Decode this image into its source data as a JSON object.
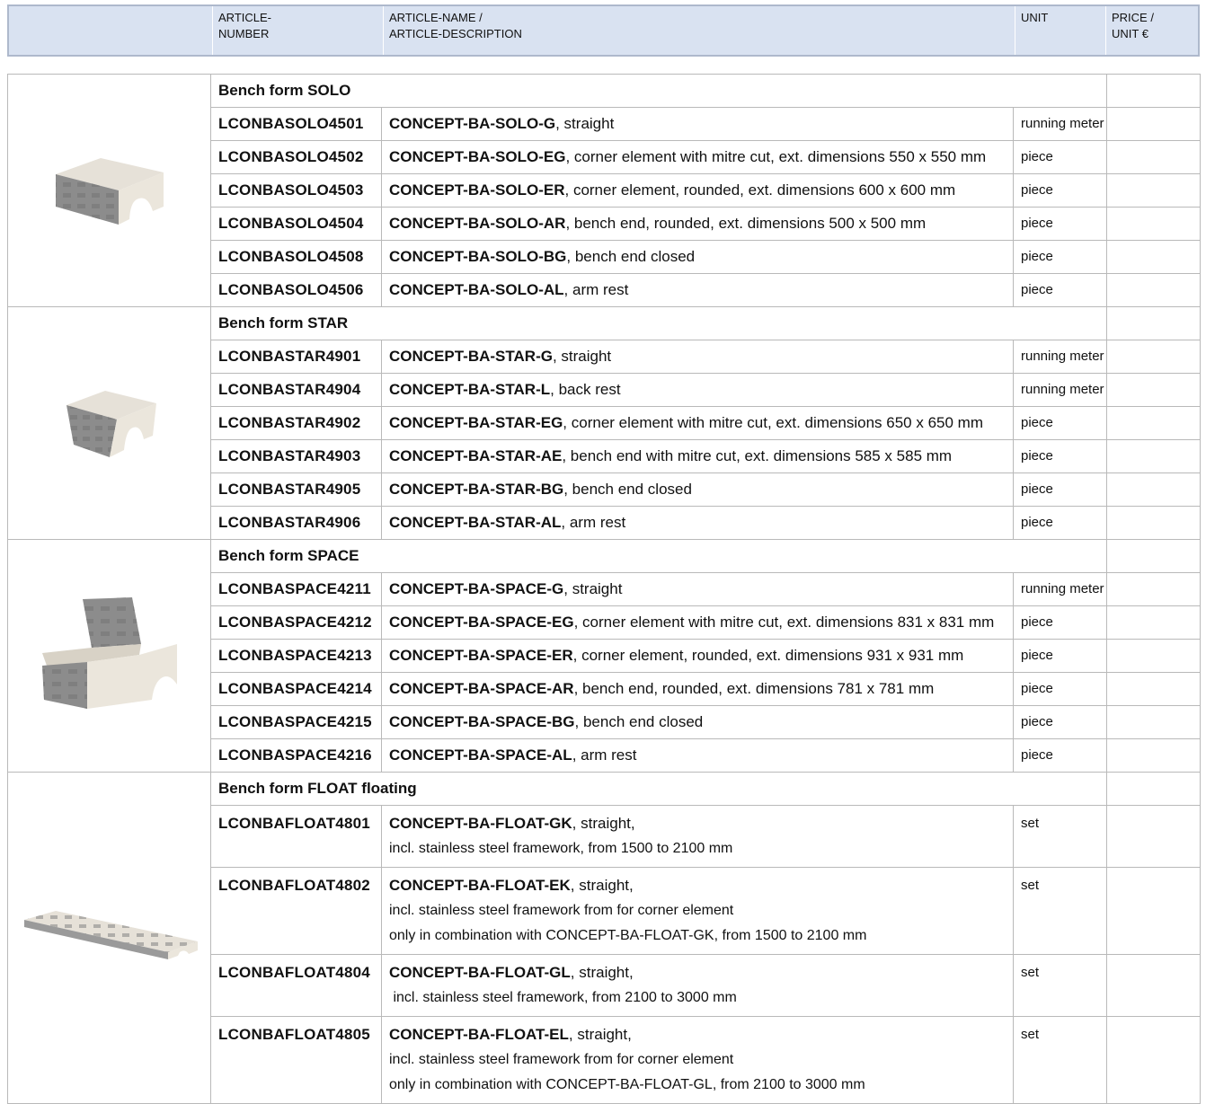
{
  "header": {
    "col_number": "ARTICLE-\nNUMBER",
    "col_name": "ARTICLE-NAME /\nARTICLE-DESCRIPTION",
    "col_unit": "UNIT",
    "col_price": "PRICE /\nUNIT €"
  },
  "groups": [
    {
      "title": "Bench form SOLO",
      "image_icon": "bench-solo-image",
      "rows": [
        {
          "number": "LCONBASOLO4501",
          "name": "CONCEPT-BA-SOLO-G",
          "desc": ", straight",
          "unit": "running meter"
        },
        {
          "number": "LCONBASOLO4502",
          "name": "CONCEPT-BA-SOLO-EG",
          "desc": ", corner element with mitre cut, ext. dimensions 550 x 550 mm",
          "unit": "piece"
        },
        {
          "number": "LCONBASOLO4503",
          "name": "CONCEPT-BA-SOLO-ER",
          "desc": ", corner element, rounded, ext. dimensions 600 x 600 mm",
          "unit": "piece"
        },
        {
          "number": "LCONBASOLO4504",
          "name": "CONCEPT-BA-SOLO-AR",
          "desc": ", bench end, rounded, ext. dimensions 500 x 500 mm",
          "unit": "piece"
        },
        {
          "number": "LCONBASOLO4508",
          "name": "CONCEPT-BA-SOLO-BG",
          "desc": ", bench end closed",
          "unit": "piece"
        },
        {
          "number": "LCONBASOLO4506",
          "name": "CONCEPT-BA-SOLO-AL",
          "desc": ", arm rest",
          "unit": "piece"
        }
      ]
    },
    {
      "title": "Bench form STAR",
      "image_icon": "bench-star-image",
      "rows": [
        {
          "number": "LCONBASTAR4901",
          "name": "CONCEPT-BA-STAR-G",
          "desc": ", straight",
          "unit": "running meter"
        },
        {
          "number": "LCONBASTAR4904",
          "name": "CONCEPT-BA-STAR-L",
          "desc": ", back rest",
          "unit": "running meter"
        },
        {
          "number": "LCONBASTAR4902",
          "name": "CONCEPT-BA-STAR-EG",
          "desc": ", corner element with mitre cut, ext. dimensions 650 x 650 mm",
          "unit": "piece"
        },
        {
          "number": "LCONBASTAR4903",
          "name": "CONCEPT-BA-STAR-AE",
          "desc": ", bench end with mitre cut, ext. dimensions 585 x 585 mm",
          "unit": "piece"
        },
        {
          "number": "LCONBASTAR4905",
          "name": "CONCEPT-BA-STAR-BG",
          "desc": ", bench end closed",
          "unit": "piece"
        },
        {
          "number": "LCONBASTAR4906",
          "name": "CONCEPT-BA-STAR-AL",
          "desc": ", arm rest",
          "unit": "piece"
        }
      ]
    },
    {
      "title": "Bench form SPACE",
      "image_icon": "bench-space-image",
      "rows": [
        {
          "number": "LCONBASPACE4211",
          "name": "CONCEPT-BA-SPACE-G",
          "desc": ", straight",
          "unit": "running meter"
        },
        {
          "number": "LCONBASPACE4212",
          "name": "CONCEPT-BA-SPACE-EG",
          "desc": ", corner element with mitre cut, ext. dimensions 831 x 831 mm",
          "unit": "piece"
        },
        {
          "number": "LCONBASPACE4213",
          "name": "CONCEPT-BA-SPACE-ER",
          "desc": ", corner element, rounded, ext. dimensions 931 x 931 mm",
          "unit": "piece"
        },
        {
          "number": "LCONBASPACE4214",
          "name": "CONCEPT-BA-SPACE-AR",
          "desc": ", bench end, rounded, ext. dimensions 781 x 781 mm",
          "unit": "piece"
        },
        {
          "number": "LCONBASPACE4215",
          "name": "CONCEPT-BA-SPACE-BG",
          "desc": ", bench end closed",
          "unit": "piece"
        },
        {
          "number": "LCONBASPACE4216",
          "name": "CONCEPT-BA-SPACE-AL",
          "desc": ", arm rest",
          "unit": "piece"
        }
      ]
    },
    {
      "title": "Bench form FLOAT floating",
      "image_icon": "bench-float-image",
      "rows": [
        {
          "number": "LCONBAFLOAT4801",
          "name": "CONCEPT-BA-FLOAT-GK",
          "desc": ", straight,",
          "lines": [
            "incl. stainless steel framework, from 1500 to 2100 mm"
          ],
          "unit": "set"
        },
        {
          "number": "LCONBAFLOAT4802",
          "name": "CONCEPT-BA-FLOAT-EK",
          "desc": ", straight,",
          "lines": [
            "incl. stainless steel framework from for corner element",
            "only in combination with CONCEPT-BA-FLOAT-GK, from 1500 to 2100 mm"
          ],
          "unit": "set"
        },
        {
          "number": "LCONBAFLOAT4804",
          "name": "CONCEPT-BA-FLOAT-GL",
          "desc": ", straight,",
          "lines": [
            " incl. stainless steel framework, from 2100 to 3000 mm"
          ],
          "unit": "set"
        },
        {
          "number": "LCONBAFLOAT4805",
          "name": "CONCEPT-BA-FLOAT-EL",
          "desc": ", straight,",
          "lines": [
            "incl. stainless steel framework from for corner element",
            "only in combination with CONCEPT-BA-FLOAT-GL, from 2100 to 3000 mm"
          ],
          "unit": "set"
        }
      ]
    }
  ],
  "colors": {
    "header_bg": "#d9e2f1",
    "header_border": "#aeb9cc",
    "grid": "#b9b9b9",
    "stone": "#e3ddd2",
    "pattern": "#6f6f6f"
  }
}
